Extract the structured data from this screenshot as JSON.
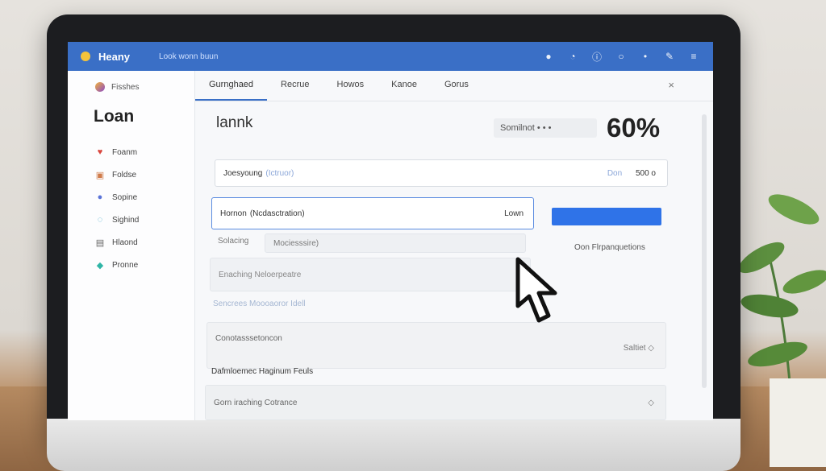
{
  "app": {
    "name": "Heany",
    "search_text": "Look wonn buun"
  },
  "titlebar_icons": [
    "chat-icon",
    "clock-icon",
    "info-icon",
    "comment-icon",
    "more-icon",
    "edit-icon",
    "menu-icon"
  ],
  "sidebar": {
    "top_label": "Fisshes",
    "title": "Loan",
    "items": [
      {
        "label": "Foanm",
        "icon": "heart-icon"
      },
      {
        "label": "Foldse",
        "icon": "calendar-icon"
      },
      {
        "label": "Sopine",
        "icon": "globe-icon"
      },
      {
        "label": "Sighind",
        "icon": "phone-icon"
      },
      {
        "label": "Hlaond",
        "icon": "document-icon"
      },
      {
        "label": "Pronne",
        "icon": "drop-icon"
      }
    ]
  },
  "tabs": [
    {
      "label": "Gurnghaed",
      "active": true
    },
    {
      "label": "Recrue",
      "active": false
    },
    {
      "label": "Howos",
      "active": false
    },
    {
      "label": "Kanoe",
      "active": false
    },
    {
      "label": "Gorus",
      "active": false
    }
  ],
  "main": {
    "title": "lannk",
    "submit_chip": "Somilnot  •  •  •",
    "percentage": "60%",
    "field1": {
      "label": "Joesyoung",
      "hint": "(Ictruor)",
      "right_label": "Don",
      "right_value": "500 o"
    },
    "field2": {
      "label": "Hornon",
      "hint": "(Ncdasctration)",
      "right": "Lown"
    },
    "side_caption": "Oon Flrpanquetions",
    "row1": {
      "label": "Solacing",
      "value": "Mociesssire)"
    },
    "panel1": "Enaching  Neloerpeatre",
    "row2": "Sencrees  Moooaoror Idell",
    "panel2": {
      "label": "Conotasssetoncon",
      "right": "Saltiet  ◇"
    },
    "row3": "Dafmloemec  Haginum  Feuls",
    "panel3": {
      "label": "Gorn  iraching  Cotrance",
      "right": "◇"
    }
  },
  "colors": {
    "titlebar": "#3a6fc6",
    "accent_button": "#2f73e8"
  }
}
